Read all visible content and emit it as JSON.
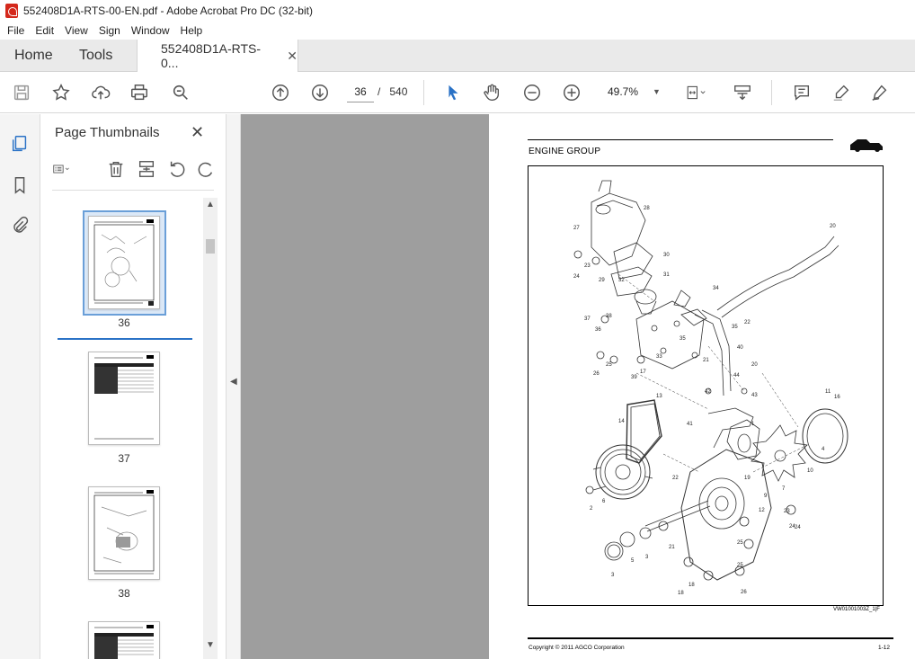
{
  "window": {
    "title": "552408D1A-RTS-00-EN.pdf - Adobe Acrobat Pro DC (32-bit)"
  },
  "menu": [
    "File",
    "Edit",
    "View",
    "Sign",
    "Window",
    "Help"
  ],
  "tabs": {
    "home": "Home",
    "tools": "Tools",
    "document": "552408D1A-RTS-0...",
    "close": "✕"
  },
  "toolbar": {
    "page_current": "36",
    "page_separator": "/",
    "page_total": "540",
    "zoom": "49.7%"
  },
  "thumbnails_panel": {
    "title": "Page Thumbnails",
    "close": "✕",
    "pages": [
      "36",
      "37",
      "38"
    ]
  },
  "document": {
    "header": "ENGINE GROUP",
    "figure_id": "VW01001003Z_1|F",
    "copyright": "Copyright © 2011 AGCO Corporation",
    "page_number": "1-12",
    "callouts": [
      "27",
      "28",
      "30",
      "31",
      "32",
      "29",
      "23",
      "24",
      "20",
      "34",
      "35",
      "22",
      "37",
      "38",
      "36",
      "25",
      "33",
      "40",
      "35",
      "21",
      "26",
      "39",
      "17",
      "20",
      "44",
      "42",
      "43",
      "13",
      "41",
      "16",
      "11",
      "1",
      "14",
      "10",
      "19",
      "4",
      "22",
      "9",
      "7",
      "2",
      "6",
      "12",
      "23",
      "24",
      "21",
      "25",
      "3",
      "5",
      "3",
      "24",
      "18",
      "25",
      "18",
      "26"
    ]
  },
  "colors": {
    "accent": "#2a72c6",
    "selection": "#dbe8f7",
    "doc_bg": "#9e9e9e",
    "pdf_red": "#d4281c"
  }
}
